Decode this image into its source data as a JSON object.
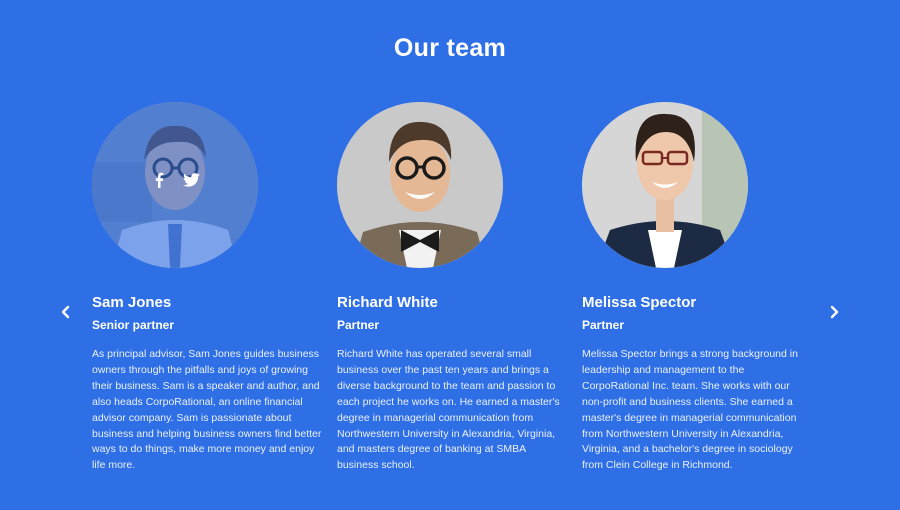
{
  "section": {
    "title": "Our team"
  },
  "carousel": {
    "prev_icon": "chevron-left-icon",
    "next_icon": "chevron-right-icon"
  },
  "members": [
    {
      "name": "Sam Jones",
      "role": "Senior partner",
      "bio": "As principal advisor, Sam Jones guides business owners through the pitfalls and joys of growing their business. Sam is a speaker and author, and also heads CorpoRational, an online financial advisor company. Sam is passionate about business and helping business owners find better ways to do things, make more money and enjoy life more.",
      "social_icons": [
        "facebook-icon",
        "twitter-icon"
      ]
    },
    {
      "name": "Richard White",
      "role": "Partner",
      "bio": "Richard White has operated several small business over the past ten years and brings a diverse background to the team and passion to each project he works on. He earned a master's degree in managerial communication from Northwestern University in Alexandria, Virginia, and masters degree of banking at SMBA business school."
    },
    {
      "name": "Melissa Spector",
      "role": "Partner",
      "bio": "Melissa Spector brings a strong background in leadership and management to the CorpoRational Inc. team. She works with our non-profit and business clients. She earned a master's degree in managerial communication from Northwestern University in Alexandria, Virginia, and a bachelor's degree in sociology from Clein College in Richmond."
    }
  ],
  "colors": {
    "background": "#2f6fe6",
    "overlay": "#2f6fe6",
    "text": "#ffffff"
  }
}
